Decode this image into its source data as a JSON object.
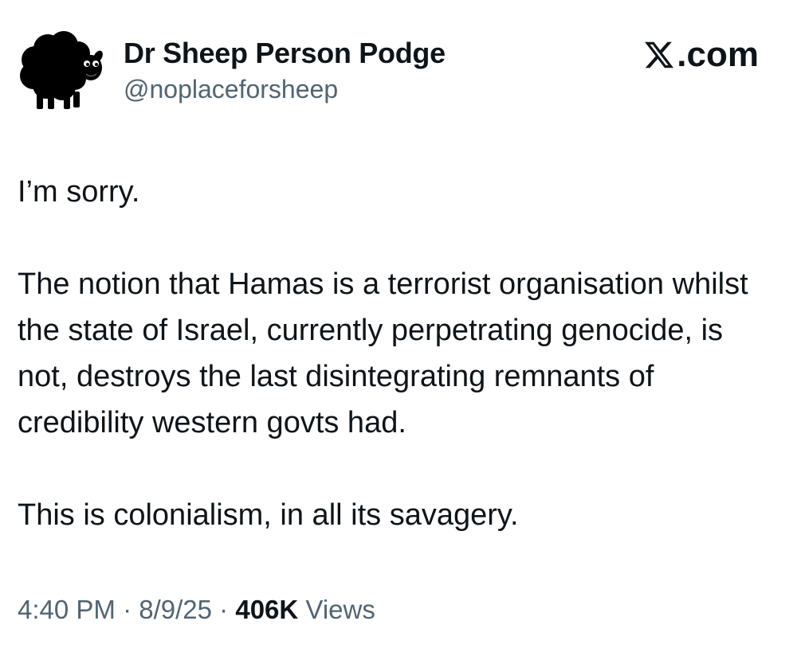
{
  "author": {
    "display_name": "Dr Sheep Person Podge",
    "handle": "@noplaceforsheep",
    "avatar_icon": "black-sheep-avatar"
  },
  "brand": {
    "icon": "x-logo-icon",
    "label": ".com"
  },
  "tweet": {
    "paragraphs": [
      "I’m sorry.",
      "The notion that Hamas is a terrorist organisation whilst the state of Israel, currently perpetrating genocide, is not, destroys the last disintegrating remnants of credibility western govts had.",
      "This is colonialism, in all its savagery."
    ]
  },
  "meta": {
    "time": "4:40 PM",
    "separator": "·",
    "date": "8/9/25",
    "views_count": "406K",
    "views_label": "Views"
  },
  "colors": {
    "text_primary": "#0f1419",
    "text_secondary": "#536471",
    "background": "#ffffff"
  }
}
